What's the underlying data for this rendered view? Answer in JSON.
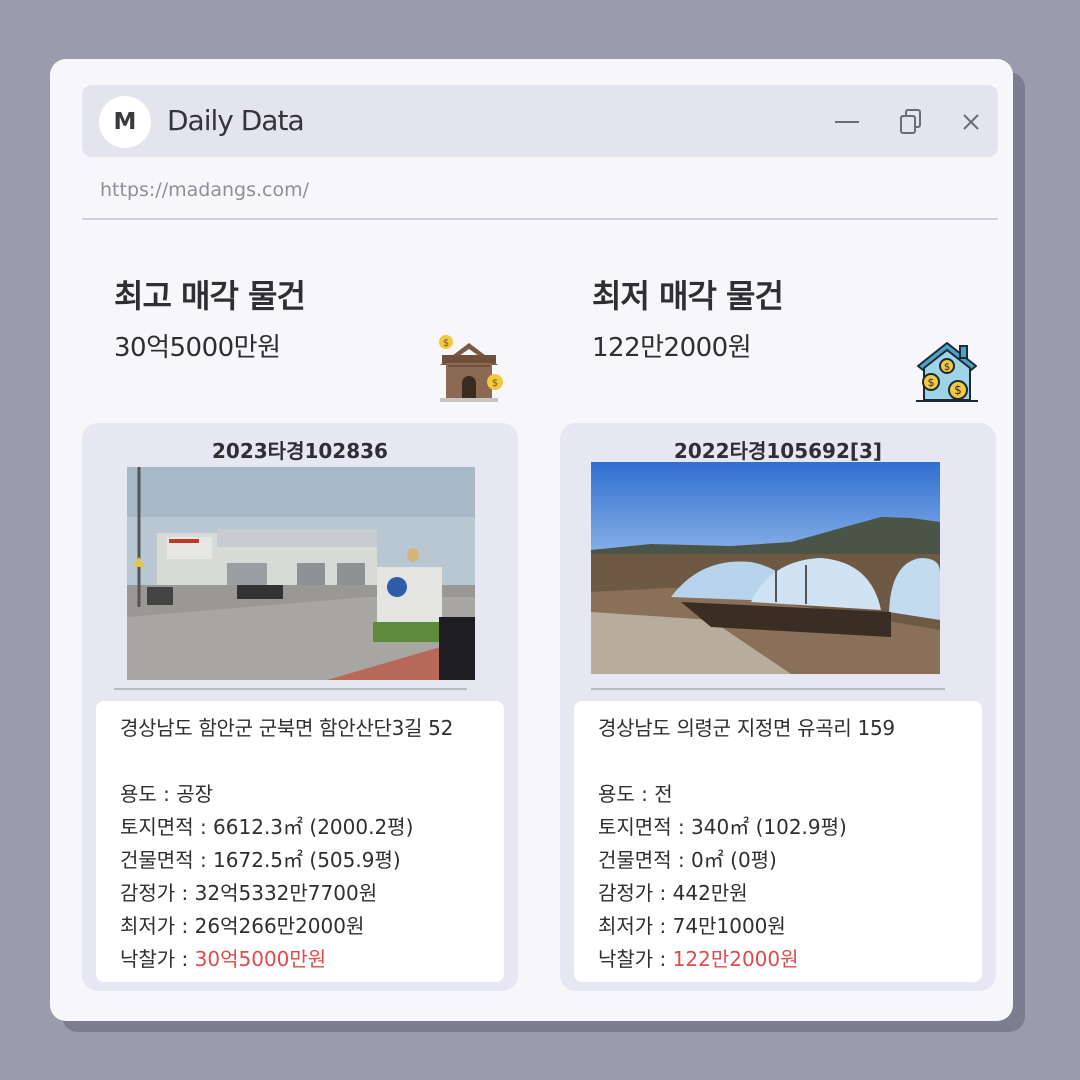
{
  "window": {
    "logo_letter": "M",
    "title": "Daily Data",
    "url": "https://madangs.com/",
    "controls": [
      "minimize-icon",
      "restore-icon",
      "close-icon"
    ]
  },
  "highest": {
    "heading": "최고 매각 물건",
    "price": "30억5000만원",
    "icon": "house-money-icon",
    "case_no": "2023타경102836",
    "address": "경상남도 함안군 군북면 함안산단3길 52",
    "usage": "용도 : 공장",
    "land_area": "토지면적 : 6612.3㎡ (2000.2평)",
    "building_area": "건물면적 : 1672.5㎡ (505.9평)",
    "appraisal": "감정가 : 32억5332만7700원",
    "minimum": "최저가 : 26억266만2000원",
    "winning_label": "낙찰가 : ",
    "winning_value": "30억5000만원"
  },
  "lowest": {
    "heading": "최저 매각 물건",
    "price": "122만2000원",
    "icon": "house-coins-icon",
    "case_no": "2022타경105692[3]",
    "address": "경상남도 의령군 지정면 유곡리 159",
    "usage": "용도 : 전",
    "land_area": "토지면적 : 340㎡ (102.9평)",
    "building_area": "건물면적 : 0㎡ (0평)",
    "appraisal": "감정가 : 442만원",
    "minimum": "최저가 : 74만1000원",
    "winning_label": "낙찰가 : ",
    "winning_value": "122만2000원"
  },
  "colors": {
    "accent_red": "#e04a4a",
    "background": "#9a9cae",
    "window": "#f6f6fb"
  }
}
